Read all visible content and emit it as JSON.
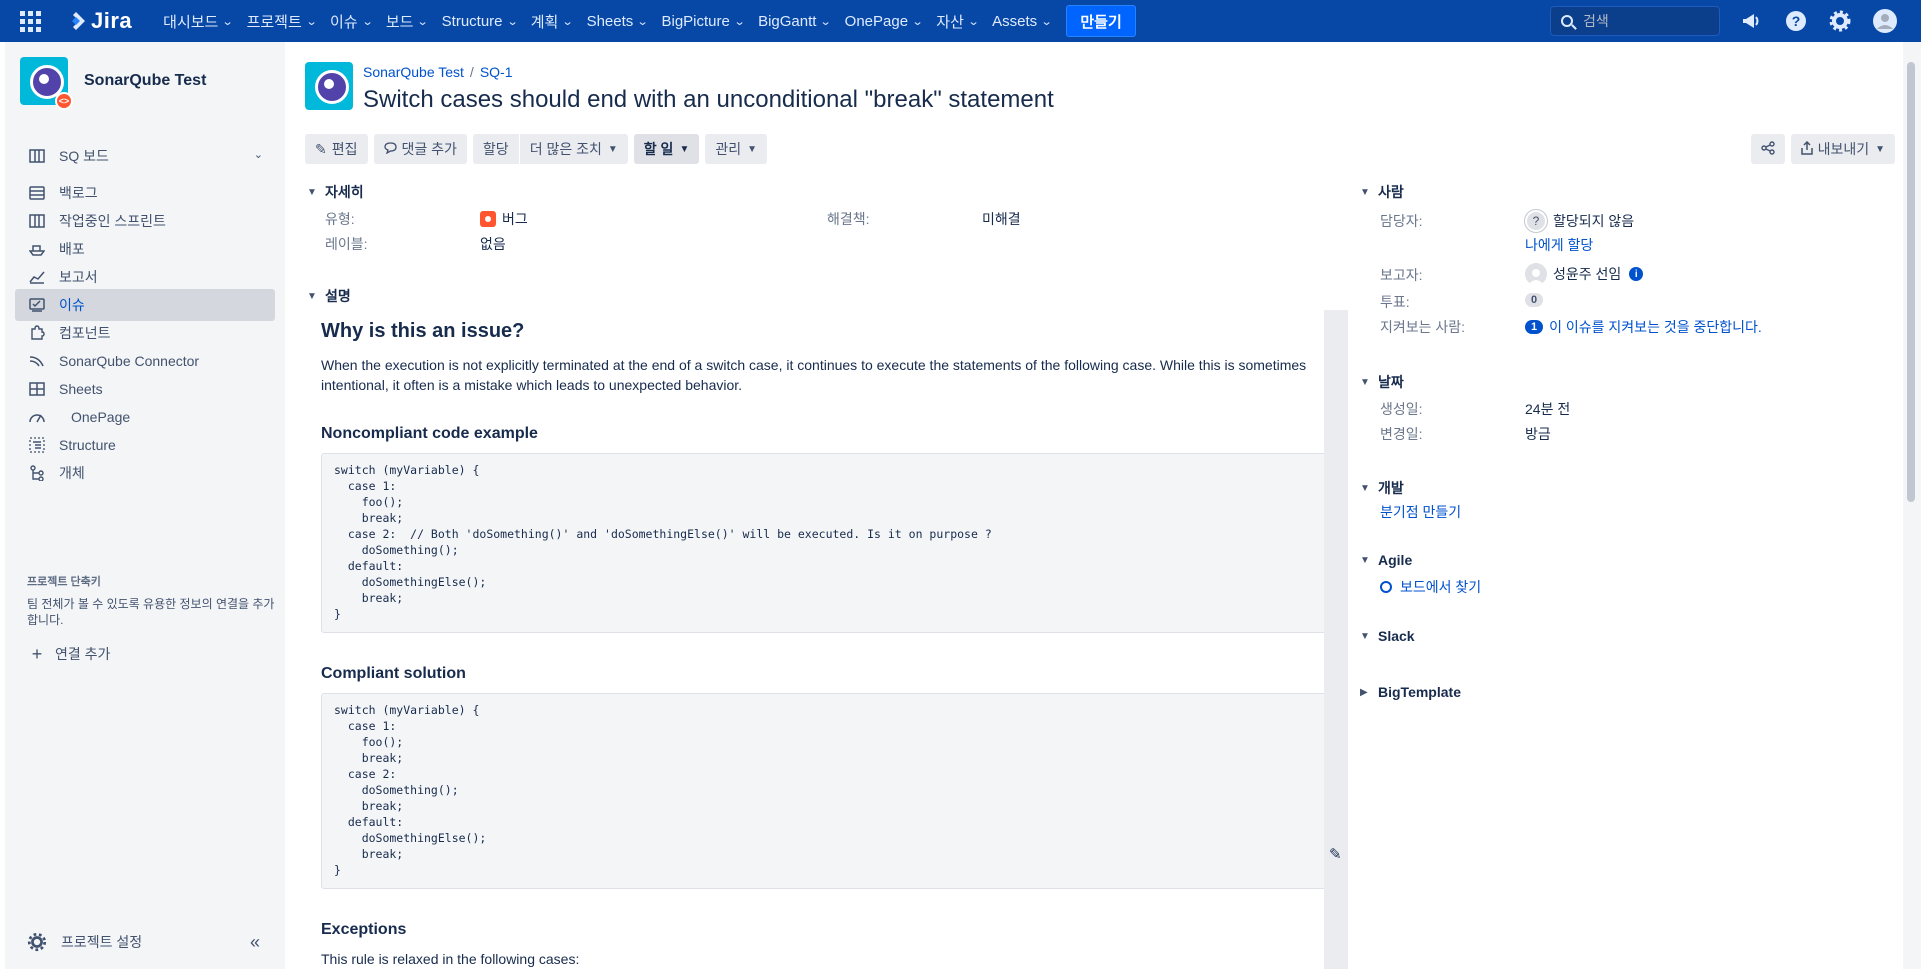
{
  "topnav": {
    "logo": "Jira",
    "items": [
      "대시보드",
      "프로젝트",
      "이슈",
      "보드",
      "Structure",
      "계획",
      "Sheets",
      "BigPicture",
      "BigGantt",
      "OnePage",
      "자산",
      "Assets"
    ],
    "create_label": "만들기",
    "search_placeholder": "검색"
  },
  "sidebar": {
    "project_name": "SonarQube Test",
    "board_label": "SQ 보드",
    "items": [
      "백로그",
      "작업중인 스프린트",
      "배포",
      "보고서",
      "이슈",
      "컴포넌트",
      "SonarQube Connector",
      "Sheets",
      "OnePage",
      "Structure",
      "개체"
    ],
    "active_index": 4,
    "shortcuts_title": "프로젝트 단축키",
    "shortcuts_note": "팀 전체가 볼 수 있도록 유용한 정보의 연결을 추가합니다.",
    "add_link": "연결 추가",
    "settings": "프로젝트 설정"
  },
  "issue": {
    "project": "SonarQube Test",
    "key": "SQ-1",
    "title": "Switch cases should end with an unconditional \"break\" statement"
  },
  "toolbar": {
    "edit": "편집",
    "comment": "댓글 추가",
    "assign": "할당",
    "more": "더 많은 조치",
    "status": "할 일",
    "manage": "관리",
    "export": "내보내기"
  },
  "details": {
    "title": "자세히",
    "type_label": "유형:",
    "type_value": "버그",
    "resolution_label": "해결책:",
    "resolution_value": "미해결",
    "labels_label": "레이블:",
    "labels_value": "없음"
  },
  "description": {
    "title": "설명",
    "heading": "Why is this an issue?",
    "intro": "When the execution is not explicitly terminated at the end of a switch case, it continues to execute the statements of the following case. While this is sometimes intentional, it often is a mistake which leads to unexpected behavior.",
    "noncompliant_title": "Noncompliant code example",
    "noncompliant_code": "switch (myVariable) {\n  case 1:\n    foo();\n    break;\n  case 2:  // Both 'doSomething()' and 'doSomethingElse()' will be executed. Is it on purpose ?\n    doSomething();\n  default:\n    doSomethingElse();\n    break;\n}",
    "compliant_title": "Compliant solution",
    "compliant_code": "switch (myVariable) {\n  case 1:\n    foo();\n    break;\n  case 2:\n    doSomething();\n    break;\n  default:\n    doSomethingElse();\n    break;\n}",
    "exceptions_title": "Exceptions",
    "exceptions_text": "This rule is relaxed in the following cases:"
  },
  "people": {
    "title": "사람",
    "assignee_label": "담당자:",
    "assignee_value": "할당되지 않음",
    "assign_to_me": "나에게 할당",
    "reporter_label": "보고자:",
    "reporter_value": "성윤주 선임",
    "votes_label": "투표:",
    "votes_value": "0",
    "watchers_label": "지켜보는 사람:",
    "watchers_count": "1",
    "watchers_action": "이 이슈를 지켜보는 것을 중단합니다."
  },
  "dates": {
    "title": "날짜",
    "created_label": "생성일:",
    "created_value": "24분 전",
    "updated_label": "변경일:",
    "updated_value": "방금"
  },
  "development": {
    "title": "개발",
    "create_branch": "분기점 만들기"
  },
  "agile": {
    "title": "Agile",
    "find_on_board": "보드에서 찾기"
  },
  "slack": {
    "title": "Slack"
  },
  "bigtemplate": {
    "title": "BigTemplate"
  },
  "colors": {
    "nav_bg": "#0747a6",
    "create_bg": "#0065ff",
    "link": "#0052cc",
    "bug": "#ff5630"
  }
}
